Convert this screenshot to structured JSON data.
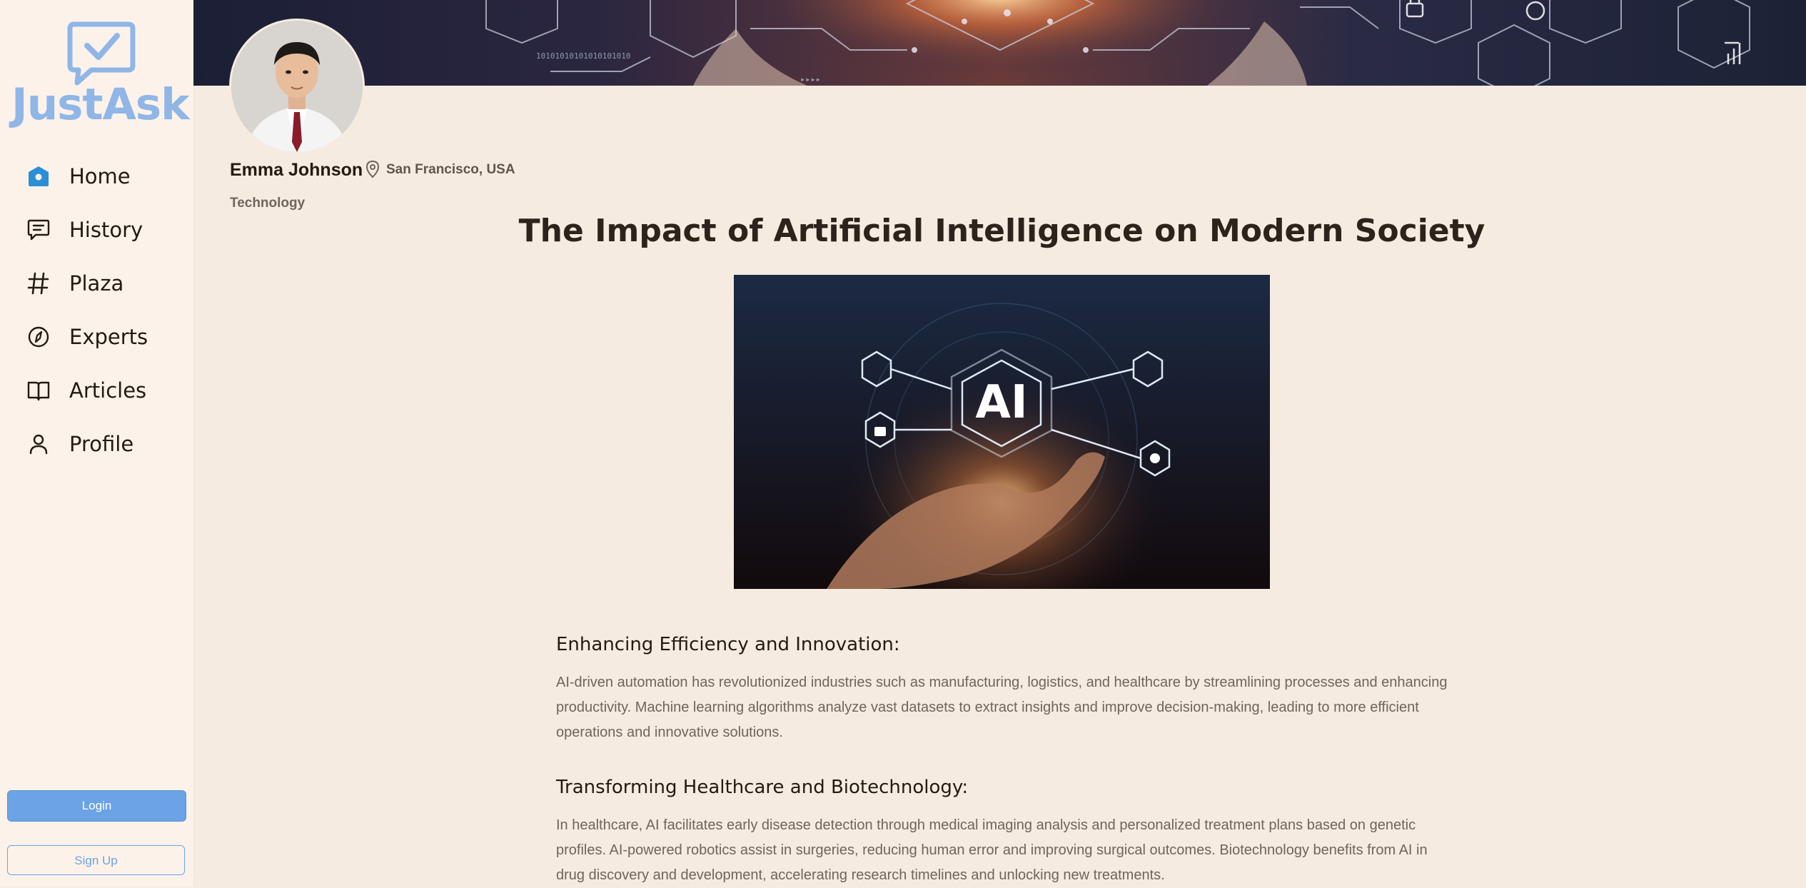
{
  "brand": {
    "name": "JustAsk",
    "color": "#8fb6e6"
  },
  "nav": {
    "items": [
      {
        "label": "Home",
        "icon": "home-icon",
        "active": true
      },
      {
        "label": "History",
        "icon": "chat-bubble-icon"
      },
      {
        "label": "Plaza",
        "icon": "hash-icon"
      },
      {
        "label": "Experts",
        "icon": "compass-icon"
      },
      {
        "label": "Articles",
        "icon": "book-icon"
      },
      {
        "label": "Profile",
        "icon": "user-icon"
      }
    ]
  },
  "auth": {
    "login_label": "Login",
    "signup_label": "Sign Up"
  },
  "author": {
    "name": "Emma Johnson",
    "location": "San Francisco, USA",
    "category": "Technology"
  },
  "article": {
    "title": "The Impact of Artificial Intelligence on Modern Society",
    "hero_text": "AI",
    "sections": [
      {
        "heading": "Enhancing Efficiency and Innovation:",
        "body": "AI-driven automation has revolutionized industries such as manufacturing, logistics, and healthcare by streamlining processes and enhancing productivity. Machine learning algorithms analyze vast datasets to extract insights and improve decision-making, leading to more efficient operations and innovative solutions."
      },
      {
        "heading": "Transforming Healthcare and Biotechnology:",
        "body": "In healthcare, AI facilitates early disease detection through medical imaging analysis and personalized treatment plans based on genetic profiles. AI-powered robotics assist in surgeries, reducing human error and improving surgical outcomes. Biotechnology benefits from AI in drug discovery and development, accelerating research timelines and unlocking new treatments."
      }
    ]
  },
  "colors": {
    "accent": "#6ba3e6",
    "background": "#f6ebe0",
    "sidebar": "#fcf2ea",
    "home_icon": "#2b8fd6"
  }
}
